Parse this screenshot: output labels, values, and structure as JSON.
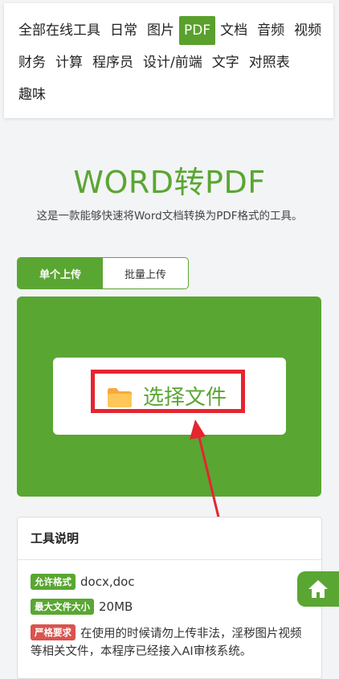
{
  "nav": {
    "items": [
      {
        "label": "全部在线工具"
      },
      {
        "label": "日常"
      },
      {
        "label": "图片"
      },
      {
        "label": "PDF",
        "active": true
      },
      {
        "label": "文档"
      },
      {
        "label": "音频"
      },
      {
        "label": "视频"
      },
      {
        "label": "财务"
      },
      {
        "label": "计算"
      },
      {
        "label": "程序员"
      },
      {
        "label": "设计/前端"
      },
      {
        "label": "文字"
      },
      {
        "label": "对照表"
      },
      {
        "label": "趣味"
      }
    ]
  },
  "page": {
    "title": "WORD转PDF",
    "subtitle": "这是一款能够快速将Word文档转换为PDF格式的工具。"
  },
  "tabs": [
    {
      "label": "单个上传",
      "active": true
    },
    {
      "label": "批量上传",
      "active": false
    }
  ],
  "upload": {
    "label": "选择文件",
    "icon": "folder-icon"
  },
  "info": {
    "heading": "工具说明",
    "format": {
      "badge": "允许格式",
      "value": "docx,doc"
    },
    "max_size": {
      "badge": "最大文件大小",
      "value": "20MB"
    },
    "notice": {
      "badge": "严格要求",
      "value": "在使用的时候请勿上传非法，淫秽图片视频等相关文件，本程序已经接入AI审核系统。"
    }
  },
  "home_button": {
    "icon": "home-icon"
  },
  "colors": {
    "accent": "#5aa632",
    "highlight": "#e5252f",
    "warning": "#d9534f"
  }
}
